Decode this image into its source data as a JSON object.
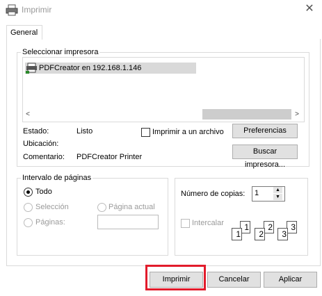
{
  "window": {
    "title": "Imprimir",
    "close_icon": "close-icon"
  },
  "tabs": [
    {
      "label": "General"
    }
  ],
  "printer_group": {
    "label": "Seleccionar impresora",
    "printers": [
      {
        "name": "PDFCreator en 192.168.1.146",
        "selected": true
      }
    ],
    "status_label": "Estado:",
    "status_value": "Listo",
    "location_label": "Ubicación:",
    "location_value": "",
    "comment_label": "Comentario:",
    "comment_value": "PDFCreator Printer",
    "print_to_file_label": "Imprimir a un archivo",
    "print_to_file_checked": false,
    "preferences_button": "Preferencias",
    "find_printer_button": "Buscar impresora..."
  },
  "page_range": {
    "label": "Intervalo de páginas",
    "all_label": "Todo",
    "selection_label": "Selección",
    "current_page_label": "Página actual",
    "pages_label": "Páginas:",
    "pages_value": "",
    "selected_option": "all"
  },
  "copies": {
    "label": "Número de copias:",
    "value": "1",
    "collate_label": "Intercalar",
    "collate_checked": false,
    "collate_sheets": [
      "1",
      "1",
      "2",
      "2",
      "3",
      "3"
    ]
  },
  "footer": {
    "print_button": "Imprimir",
    "cancel_button": "Cancelar",
    "apply_button": "Aplicar"
  },
  "colors": {
    "highlight_border": "#e21b2b",
    "selected_item": "#d9d9d9"
  }
}
